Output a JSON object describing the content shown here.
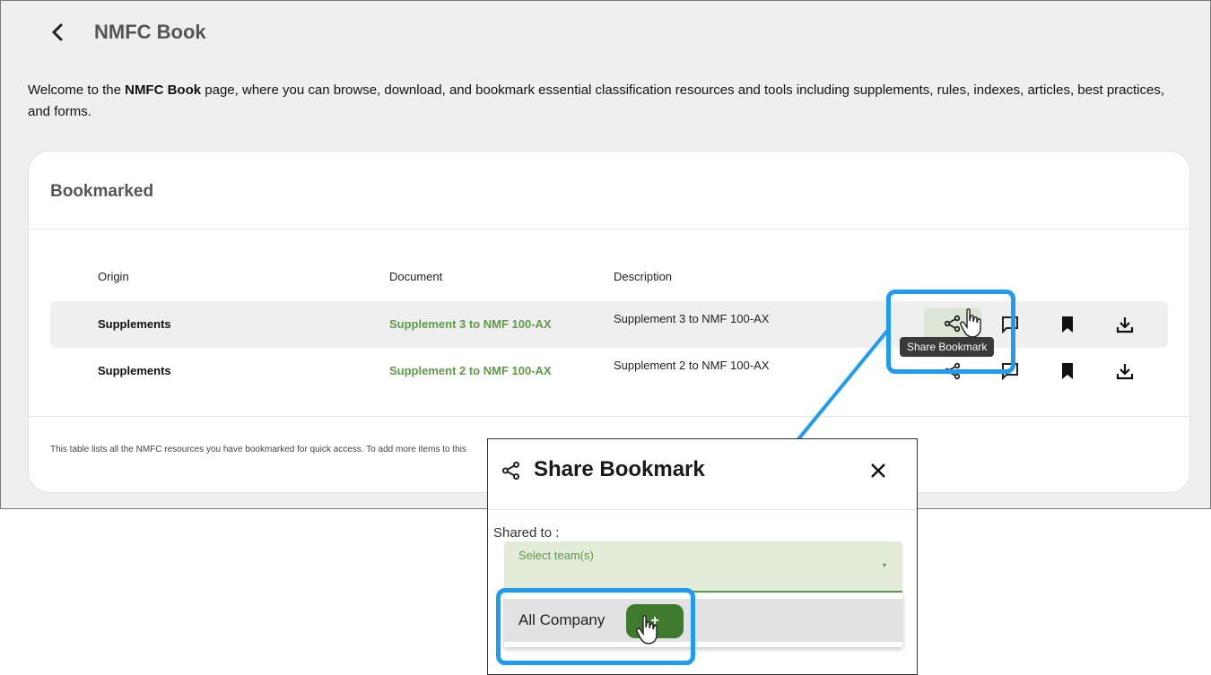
{
  "header": {
    "title": "NMFC Book"
  },
  "intro": {
    "prefix": "Welcome to the ",
    "bold": "NMFC Book",
    "suffix": " page, where you can browse, download, and bookmark essential classification resources and tools including supplements, rules, indexes, articles, best practices, and forms."
  },
  "bookmarked": {
    "title": "Bookmarked",
    "columns": [
      "Origin",
      "Document",
      "Description"
    ],
    "rows": [
      {
        "origin": "Supplements",
        "document": "Supplement 3 to NMF 100-AX",
        "description": "Supplement 3 to NMF 100-AX"
      },
      {
        "origin": "Supplements",
        "document": "Supplement 2 to NMF 100-AX",
        "description": "Supplement 2 to NMF 100-AX"
      }
    ],
    "footnote": "This table lists all the NMFC resources you have bookmarked for quick access. To add more items to this"
  },
  "tooltip": "Share Bookmark",
  "modal": {
    "title": "Share Bookmark",
    "shared_to_label": "Shared to :",
    "select_placeholder": "Select team(s)",
    "option": "All Company",
    "add_label": "+"
  },
  "colors": {
    "accent_green": "#5e9a48",
    "button_green": "#3f7a2e",
    "callout_blue": "#1f9cef"
  },
  "icons": [
    "back-icon",
    "share-icon",
    "comment-icon",
    "bookmark-icon",
    "download-icon",
    "close-icon",
    "cursor-hand-icon"
  ]
}
